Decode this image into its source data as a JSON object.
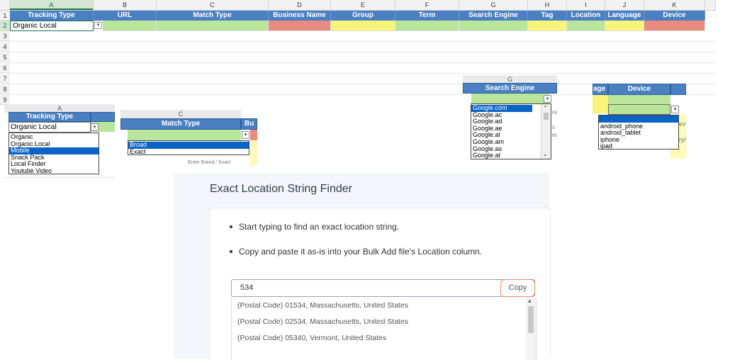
{
  "sheet": {
    "columns": [
      "A",
      "B",
      "C",
      "D",
      "E",
      "F",
      "G",
      "H",
      "I",
      "J",
      "K"
    ],
    "rows": [
      "1",
      "2",
      "3",
      "4",
      "5",
      "6",
      "7",
      "8",
      "9"
    ],
    "headers": [
      "Tracking Type",
      "URL",
      "Match Type",
      "Business Name",
      "Group",
      "Term",
      "Search Engine",
      "Tag",
      "Location",
      "Language",
      "Device"
    ],
    "active_value": "Organic Local",
    "dropdown_arrow": "▾"
  },
  "tracking_snippet": {
    "col_letter": "A",
    "header": "Tracking Type",
    "value": "Organic Local",
    "options": [
      "Organic",
      "Organic Local",
      "Mobile",
      "Snack Pack",
      "Local Finder",
      "Youtube Video"
    ],
    "highlighted_index": 2
  },
  "match_snippet": {
    "col_letter": "C",
    "header": "Match Type",
    "next_header": "Bu",
    "options": [
      "Broad",
      "Exact"
    ],
    "highlighted_index": 0,
    "faint_text": "Enter Brand / Exact"
  },
  "engine_snippet": {
    "col_letter": "G",
    "header": "Search Engine",
    "options": [
      "Google.com",
      "Google.ac",
      "Google.ad",
      "Google.ae",
      "Google.al",
      "Google.am",
      "Google.as",
      "Google.at"
    ],
    "highlighted_index": 0,
    "side_text": [
      "re",
      "s E",
      "ec"
    ]
  },
  "device_snippet": {
    "prev_header": "age",
    "header": "Device",
    "options": [
      "",
      "android_phone",
      "android_tablet",
      "iphone",
      "ipad"
    ],
    "highlighted_index": 0,
    "side_text": [
      "ev",
      "ry/"
    ]
  },
  "finder": {
    "title": "Exact Location String Finder",
    "bullets": [
      "Start typing to find an exact location string.",
      "Copy and paste it as-is into your Bulk Add file's Location column."
    ],
    "search_value": "534",
    "copy_label": "Copy",
    "results": [
      "(Postal Code) 01534, Massachusetts, United States",
      "(Postal Code) 02534, Massachusetts, United States",
      "(Postal Code) 05340, Vermont, United States"
    ]
  }
}
